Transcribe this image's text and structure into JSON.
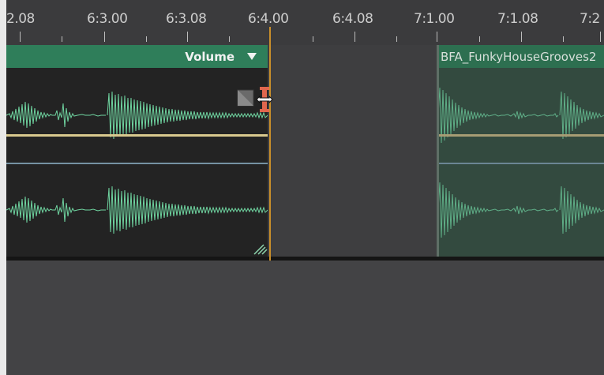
{
  "ruler": {
    "labels": [
      "2.08",
      "6:3.00",
      "6:3.08",
      "6:4.00",
      "6:4.08",
      "7:1.00",
      "7:1.08",
      "7:2"
    ]
  },
  "clips": [
    {
      "name": "Volume",
      "menu_icon": "chevron-down-icon",
      "color": "#2f7e5a"
    },
    {
      "name": "BFA_FunkyHouseGrooves2",
      "color": "#2d6f50"
    }
  ],
  "colors": {
    "waveform": "#6fd4a0",
    "waveform_dim": "#5fae87",
    "volume_envelope": "#d9c98e",
    "pan_envelope": "#7592a3",
    "playhead": "#c98f2b",
    "trim_cursor": "#e0664e"
  },
  "cursor": {
    "icon": "trim-resize-cursor-icon"
  }
}
